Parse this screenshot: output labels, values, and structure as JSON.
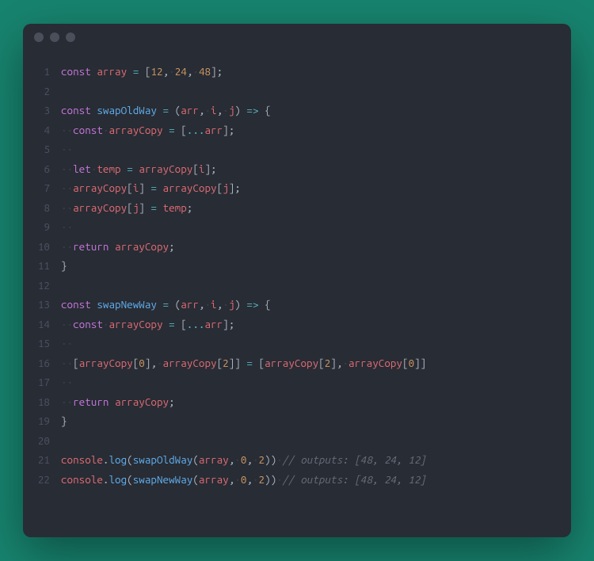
{
  "lines": [
    {
      "n": 1,
      "tokens": [
        [
          "kw",
          "const"
        ],
        [
          "pun",
          " "
        ],
        [
          "var",
          "array"
        ],
        [
          "pun",
          " "
        ],
        [
          "op",
          "="
        ],
        [
          "pun",
          " ["
        ],
        [
          "num",
          "12"
        ],
        [
          "pun",
          ","
        ],
        [
          "ws",
          "·"
        ],
        [
          "num",
          "24"
        ],
        [
          "pun",
          ","
        ],
        [
          "ws",
          "·"
        ],
        [
          "num",
          "48"
        ],
        [
          "pun",
          "];"
        ]
      ]
    },
    {
      "n": 2,
      "tokens": []
    },
    {
      "n": 3,
      "tokens": [
        [
          "kw",
          "const"
        ],
        [
          "pun",
          " "
        ],
        [
          "fn",
          "swapOldWay"
        ],
        [
          "pun",
          " "
        ],
        [
          "op",
          "="
        ],
        [
          "pun",
          " "
        ],
        [
          "pun",
          "("
        ],
        [
          "var",
          "arr"
        ],
        [
          "pun",
          ","
        ],
        [
          "ws",
          "·"
        ],
        [
          "var",
          "i"
        ],
        [
          "pun",
          ","
        ],
        [
          "ws",
          "·"
        ],
        [
          "var",
          "j"
        ],
        [
          "pun",
          ")"
        ],
        [
          "pun",
          " "
        ],
        [
          "op",
          "=>"
        ],
        [
          "pun",
          " {"
        ]
      ]
    },
    {
      "n": 4,
      "tokens": [
        [
          "ws",
          "··"
        ],
        [
          "kw",
          "const"
        ],
        [
          "ws",
          "·"
        ],
        [
          "var",
          "arrayCopy"
        ],
        [
          "pun",
          " "
        ],
        [
          "op",
          "="
        ],
        [
          "pun",
          " ["
        ],
        [
          "op",
          "..."
        ],
        [
          "var",
          "arr"
        ],
        [
          "pun",
          "];"
        ]
      ]
    },
    {
      "n": 5,
      "tokens": [
        [
          "ws",
          "··"
        ]
      ]
    },
    {
      "n": 6,
      "tokens": [
        [
          "ws",
          "··"
        ],
        [
          "kw",
          "let"
        ],
        [
          "ws",
          "·"
        ],
        [
          "var",
          "temp"
        ],
        [
          "pun",
          " "
        ],
        [
          "op",
          "="
        ],
        [
          "pun",
          " "
        ],
        [
          "var",
          "arrayCopy"
        ],
        [
          "pun",
          "["
        ],
        [
          "var",
          "i"
        ],
        [
          "pun",
          "];"
        ]
      ]
    },
    {
      "n": 7,
      "tokens": [
        [
          "ws",
          "··"
        ],
        [
          "var",
          "arrayCopy"
        ],
        [
          "pun",
          "["
        ],
        [
          "var",
          "i"
        ],
        [
          "pun",
          "]"
        ],
        [
          "pun",
          " "
        ],
        [
          "op",
          "="
        ],
        [
          "pun",
          " "
        ],
        [
          "var",
          "arrayCopy"
        ],
        [
          "pun",
          "["
        ],
        [
          "var",
          "j"
        ],
        [
          "pun",
          "];"
        ]
      ]
    },
    {
      "n": 8,
      "tokens": [
        [
          "ws",
          "··"
        ],
        [
          "var",
          "arrayCopy"
        ],
        [
          "pun",
          "["
        ],
        [
          "var",
          "j"
        ],
        [
          "pun",
          "]"
        ],
        [
          "pun",
          " "
        ],
        [
          "op",
          "="
        ],
        [
          "pun",
          " "
        ],
        [
          "var",
          "temp"
        ],
        [
          "pun",
          ";"
        ]
      ]
    },
    {
      "n": 9,
      "tokens": [
        [
          "ws",
          "··"
        ]
      ]
    },
    {
      "n": 10,
      "tokens": [
        [
          "ws",
          "··"
        ],
        [
          "kw",
          "return"
        ],
        [
          "pun",
          " "
        ],
        [
          "var",
          "arrayCopy"
        ],
        [
          "pun",
          ";"
        ]
      ]
    },
    {
      "n": 11,
      "tokens": [
        [
          "pun",
          "}"
        ]
      ]
    },
    {
      "n": 12,
      "tokens": []
    },
    {
      "n": 13,
      "tokens": [
        [
          "kw",
          "const"
        ],
        [
          "pun",
          " "
        ],
        [
          "fn",
          "swapNewWay"
        ],
        [
          "pun",
          " "
        ],
        [
          "op",
          "="
        ],
        [
          "pun",
          " "
        ],
        [
          "pun",
          "("
        ],
        [
          "var",
          "arr"
        ],
        [
          "pun",
          ","
        ],
        [
          "ws",
          "·"
        ],
        [
          "var",
          "i"
        ],
        [
          "pun",
          ","
        ],
        [
          "ws",
          "·"
        ],
        [
          "var",
          "j"
        ],
        [
          "pun",
          ")"
        ],
        [
          "pun",
          " "
        ],
        [
          "op",
          "=>"
        ],
        [
          "pun",
          " {"
        ]
      ]
    },
    {
      "n": 14,
      "tokens": [
        [
          "ws",
          "··"
        ],
        [
          "kw",
          "const"
        ],
        [
          "ws",
          "·"
        ],
        [
          "var",
          "arrayCopy"
        ],
        [
          "pun",
          " "
        ],
        [
          "op",
          "="
        ],
        [
          "pun",
          " ["
        ],
        [
          "op",
          "..."
        ],
        [
          "var",
          "arr"
        ],
        [
          "pun",
          "];"
        ]
      ]
    },
    {
      "n": 15,
      "tokens": [
        [
          "ws",
          "··"
        ]
      ]
    },
    {
      "n": 16,
      "tokens": [
        [
          "ws",
          "··"
        ],
        [
          "pun",
          "["
        ],
        [
          "var",
          "arrayCopy"
        ],
        [
          "pun",
          "["
        ],
        [
          "num",
          "0"
        ],
        [
          "pun",
          "],"
        ],
        [
          "ws",
          "·"
        ],
        [
          "var",
          "arrayCopy"
        ],
        [
          "pun",
          "["
        ],
        [
          "num",
          "2"
        ],
        [
          "pun",
          "]]"
        ],
        [
          "pun",
          " "
        ],
        [
          "op",
          "="
        ],
        [
          "pun",
          " ["
        ],
        [
          "var",
          "arrayCopy"
        ],
        [
          "pun",
          "["
        ],
        [
          "num",
          "2"
        ],
        [
          "pun",
          "],"
        ],
        [
          "ws",
          "·"
        ],
        [
          "var",
          "arrayCopy"
        ],
        [
          "pun",
          "["
        ],
        [
          "num",
          "0"
        ],
        [
          "pun",
          "]]"
        ]
      ]
    },
    {
      "n": 17,
      "tokens": [
        [
          "ws",
          "··"
        ]
      ]
    },
    {
      "n": 18,
      "tokens": [
        [
          "ws",
          "··"
        ],
        [
          "kw",
          "return"
        ],
        [
          "pun",
          " "
        ],
        [
          "var",
          "arrayCopy"
        ],
        [
          "pun",
          ";"
        ]
      ]
    },
    {
      "n": 19,
      "tokens": [
        [
          "pun",
          "}"
        ]
      ]
    },
    {
      "n": 20,
      "tokens": []
    },
    {
      "n": 21,
      "tokens": [
        [
          "var",
          "console"
        ],
        [
          "pun",
          "."
        ],
        [
          "fn",
          "log"
        ],
        [
          "pun",
          "("
        ],
        [
          "fn",
          "swapOldWay"
        ],
        [
          "pun",
          "("
        ],
        [
          "var",
          "array"
        ],
        [
          "pun",
          ","
        ],
        [
          "ws",
          "·"
        ],
        [
          "num",
          "0"
        ],
        [
          "pun",
          ","
        ],
        [
          "ws",
          "·"
        ],
        [
          "num",
          "2"
        ],
        [
          "pun",
          "))"
        ],
        [
          "ws",
          "·"
        ],
        [
          "cmt",
          "// outputs: [48, 24, 12]"
        ]
      ]
    },
    {
      "n": 22,
      "tokens": [
        [
          "var",
          "console"
        ],
        [
          "pun",
          "."
        ],
        [
          "fn",
          "log"
        ],
        [
          "pun",
          "("
        ],
        [
          "fn",
          "swapNewWay"
        ],
        [
          "pun",
          "("
        ],
        [
          "var",
          "array"
        ],
        [
          "pun",
          ","
        ],
        [
          "ws",
          "·"
        ],
        [
          "num",
          "0"
        ],
        [
          "pun",
          ","
        ],
        [
          "ws",
          "·"
        ],
        [
          "num",
          "2"
        ],
        [
          "pun",
          "))"
        ],
        [
          "ws",
          "·"
        ],
        [
          "cmt",
          "// outputs: [48, 24, 12]"
        ]
      ]
    }
  ]
}
